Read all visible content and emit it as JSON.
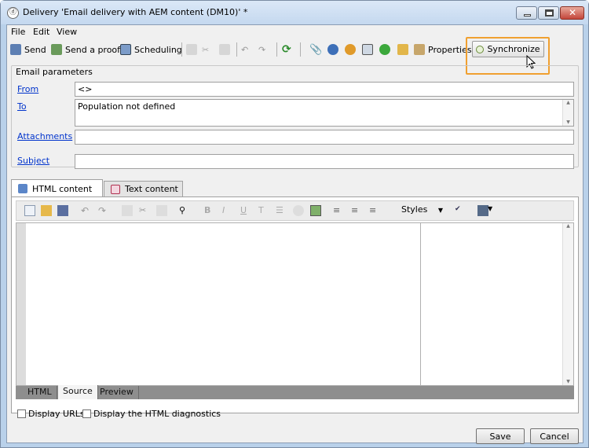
{
  "window": {
    "title": "Delivery 'Email delivery with AEM content (DM10)' *",
    "icon_glyph": "ⓓ"
  },
  "menu": [
    "File",
    "Edit",
    "View"
  ],
  "toolbar": {
    "send_label": "Send",
    "send_proof_label": "Send a proof",
    "scheduling_label": "Scheduling",
    "properties_label": "Properties",
    "synchronize_label": "Synchronize"
  },
  "email_parameters": {
    "group_title": "Email parameters",
    "from_label": "From",
    "from_value": "<>",
    "to_label": "To",
    "to_value": "Population not defined",
    "attachments_label": "Attachments",
    "attachments_value": "",
    "subject_label": "Subject",
    "subject_value": ""
  },
  "content_tabs": {
    "html": "HTML content",
    "text": "Text content"
  },
  "editor": {
    "styles_label": "Styles"
  },
  "view_tabs": [
    "HTML",
    "Source",
    "Preview"
  ],
  "options": {
    "display_urls": "Display URLs",
    "display_diagnostics": "Display the HTML diagnostics"
  },
  "footer": {
    "save": "Save",
    "cancel": "Cancel"
  },
  "colors": {
    "highlight": "#f0a030",
    "link": "#0033cc",
    "titlebar": "#c4d8ef"
  }
}
